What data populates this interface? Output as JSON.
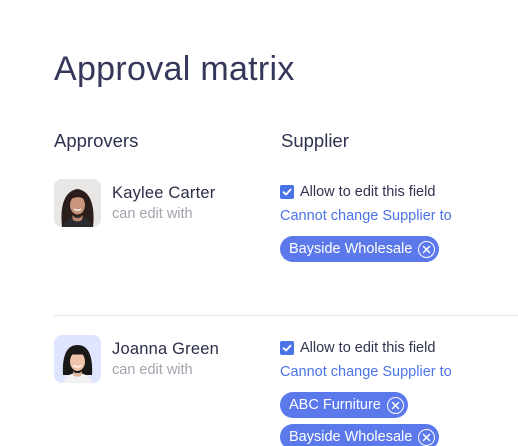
{
  "page": {
    "title": "Approval matrix"
  },
  "columns": {
    "approvers": "Approvers",
    "supplier": "Supplier"
  },
  "colors": {
    "accent": "#4b73e8",
    "chip": "#5c79ec"
  },
  "approvers": [
    {
      "name": "Kaylee Carter",
      "subtext": "can edit with",
      "allow_label": "Allow to edit this field",
      "allow_checked": true,
      "restriction": "Cannot change Supplier to",
      "chips": [
        "Bayside Wholesale"
      ]
    },
    {
      "name": "Joanna Green",
      "subtext": "can edit with",
      "allow_label": "Allow to edit this field",
      "allow_checked": true,
      "restriction": "Cannot change Supplier to",
      "chips": [
        "ABC Furniture",
        "Bayside Wholesale"
      ]
    }
  ],
  "icons": {
    "check": "checkmark-icon",
    "remove": "close-circle-icon"
  }
}
